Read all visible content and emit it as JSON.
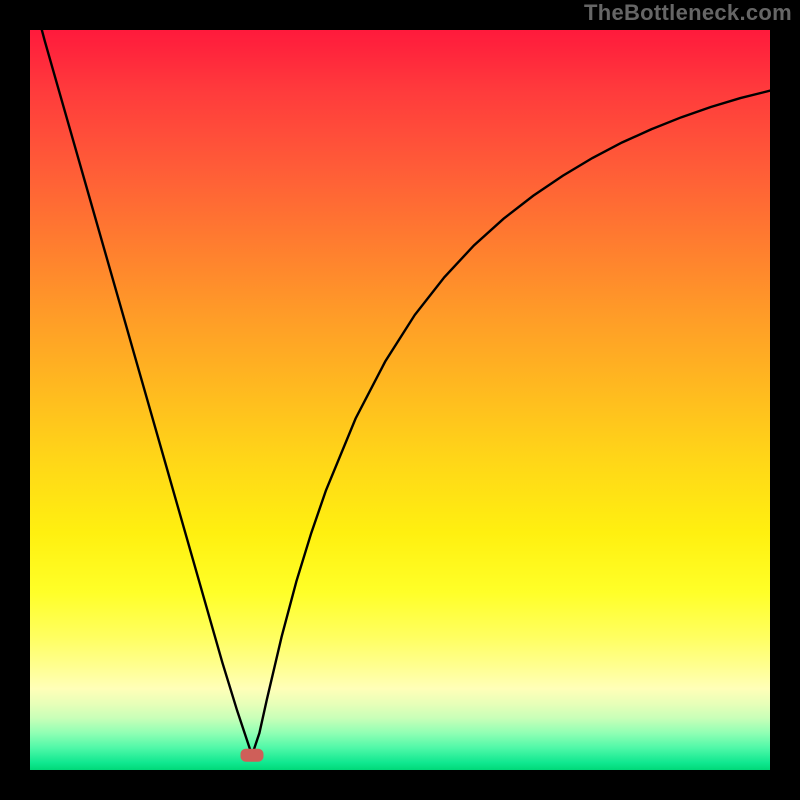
{
  "watermark": "TheBottleneck.com",
  "colors": {
    "frame_bg": "#000000",
    "watermark_text": "#666666",
    "curve_stroke": "#000000",
    "marker_fill": "#cf5f59",
    "gradient_top": "#ff1a3c",
    "gradient_bottom": "#00d878"
  },
  "chart_data": {
    "type": "line",
    "title": "",
    "xlabel": "",
    "ylabel": "",
    "xlim": [
      0,
      100
    ],
    "ylim": [
      0,
      100
    ],
    "grid": false,
    "legend": false,
    "description": "V-shaped bottleneck curve reaching minimum near x≈30 with asymmetric rise on each side",
    "marker": {
      "x": 30,
      "y": 2,
      "shape": "rounded-rect"
    },
    "x": [
      0,
      2,
      4,
      6,
      8,
      10,
      12,
      14,
      16,
      18,
      20,
      22,
      24,
      26,
      28,
      29,
      30,
      31,
      32,
      34,
      36,
      38,
      40,
      44,
      48,
      52,
      56,
      60,
      64,
      68,
      72,
      76,
      80,
      84,
      88,
      92,
      96,
      100
    ],
    "y": [
      106,
      98.5,
      91.5,
      84.5,
      77.5,
      70.5,
      63.5,
      56.5,
      49.5,
      42.5,
      35.5,
      28.5,
      21.5,
      14.5,
      8,
      5,
      2,
      5,
      9.5,
      18,
      25.5,
      32,
      37.8,
      47.5,
      55.2,
      61.5,
      66.6,
      70.9,
      74.5,
      77.6,
      80.3,
      82.7,
      84.8,
      86.6,
      88.2,
      89.6,
      90.8,
      91.8
    ]
  }
}
